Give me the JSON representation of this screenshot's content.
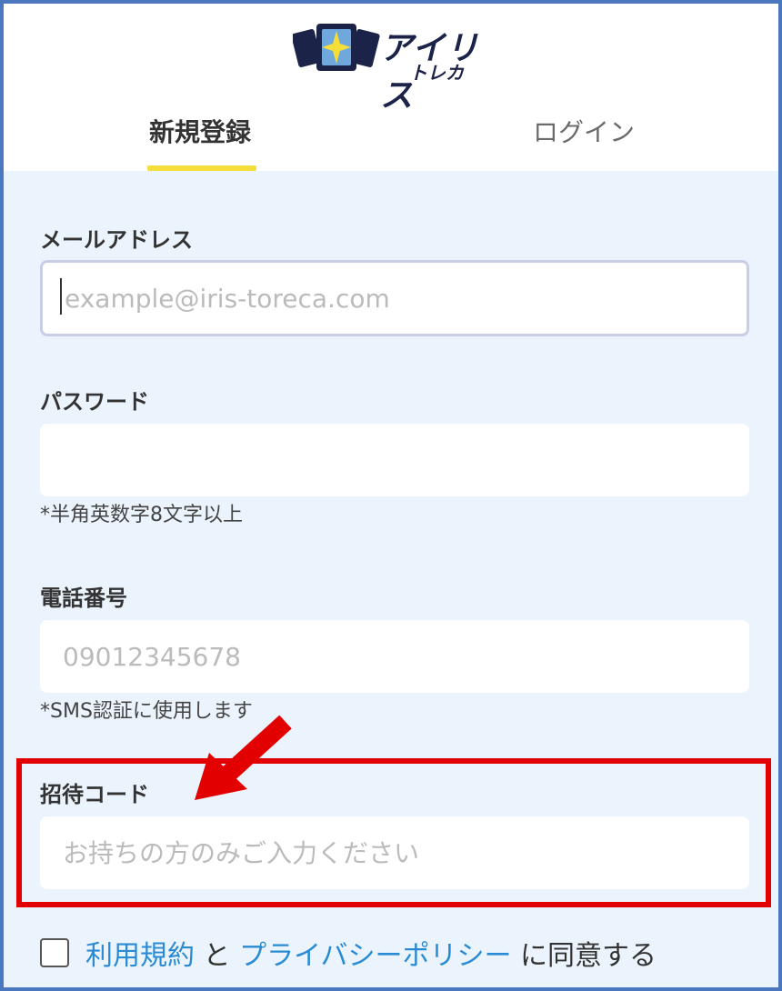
{
  "brand": {
    "title": "アイリス",
    "subtitle": "トレカ"
  },
  "tabs": [
    {
      "label": "新規登録",
      "active": true
    },
    {
      "label": "ログイン",
      "active": false
    }
  ],
  "form": {
    "email": {
      "label": "メールアドレス",
      "placeholder": "example@iris-toreca.com",
      "value": ""
    },
    "password": {
      "label": "パスワード",
      "value": "",
      "hint": "*半角英数字8文字以上"
    },
    "phone": {
      "label": "電話番号",
      "placeholder": "09012345678",
      "value": "",
      "hint": "*SMS認証に使用します"
    },
    "invite": {
      "label": "招待コード",
      "placeholder": "お持ちの方のみご入力ください",
      "value": ""
    }
  },
  "agreement": {
    "checked": false,
    "terms_link": "利用規約",
    "connector": "と",
    "privacy_link": "プライバシーポリシー",
    "suffix": "に同意する"
  },
  "colors": {
    "accent_underline": "#f5dd3a",
    "panel_bg": "#ebf4fd",
    "link": "#2a8bd3",
    "highlight": "#e30000",
    "frame": "#4a77bd"
  }
}
